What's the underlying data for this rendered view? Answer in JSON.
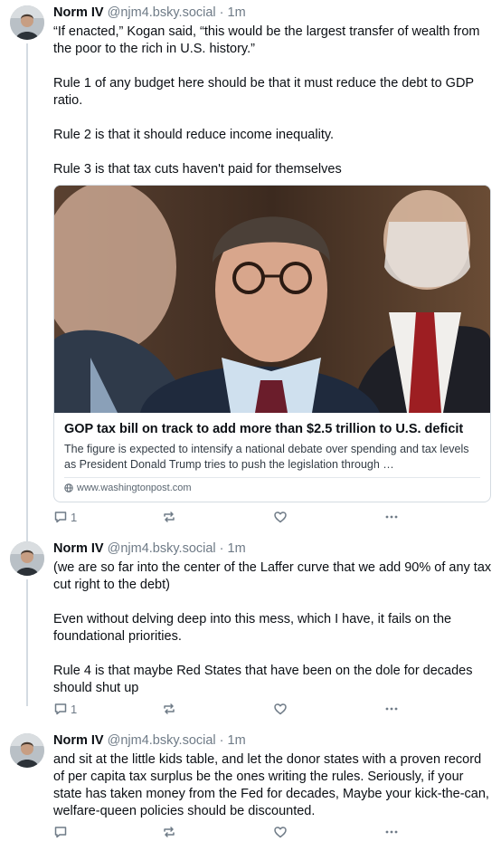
{
  "posts": [
    {
      "author": "Norm IV",
      "handle": "@njm4.bsky.social",
      "time": "· 1m",
      "paragraphs": [
        "“If enacted,” Kogan said, “this would be the largest transfer of wealth from the poor to the rich in U.S. history.”",
        "Rule 1 of any budget here should be that it must reduce the debt to GDP ratio.",
        "Rule 2 is that it should reduce income inequality.",
        "Rule 3 is that tax cuts haven't paid for themselves"
      ],
      "card": {
        "title": "GOP tax bill on track to add more than $2.5 trillion to U.S. deficit",
        "description": "The figure is expected to intensify a national debate over spending and tax levels as President Donald Trump tries to push the legislation through …",
        "domain": "www.washingtonpost.com"
      },
      "reply_count": "1",
      "repost_count": "",
      "like_count": ""
    },
    {
      "author": "Norm IV",
      "handle": "@njm4.bsky.social",
      "time": "· 1m",
      "paragraphs": [
        "(we are so far into the center of the Laffer curve that we add 90% of any tax cut right to the debt)",
        "Even without delving deep into this mess, which I have, it fails on the foundational priorities.",
        "Rule 4 is that maybe Red States that have been on the dole for decades should shut up"
      ],
      "reply_count": "1",
      "repost_count": "",
      "like_count": ""
    },
    {
      "author": "Norm IV",
      "handle": "@njm4.bsky.social",
      "time": "· 1m",
      "paragraphs": [
        "and sit at the little kids table, and let the donor states with a proven record of per capita tax surplus be the ones writing the rules. Seriously, if your state has taken money from the Fed for decades, Maybe your kick-the-can, welfare-queen policies should be discounted."
      ],
      "reply_count": "",
      "repost_count": "",
      "like_count": ""
    }
  ],
  "icons": [
    "reply-icon",
    "repost-icon",
    "like-icon",
    "more-icon",
    "globe-icon"
  ],
  "colors": {
    "muted": "#6f7b87",
    "thread_line": "#d4dbe2",
    "text": "#0b0f14"
  }
}
